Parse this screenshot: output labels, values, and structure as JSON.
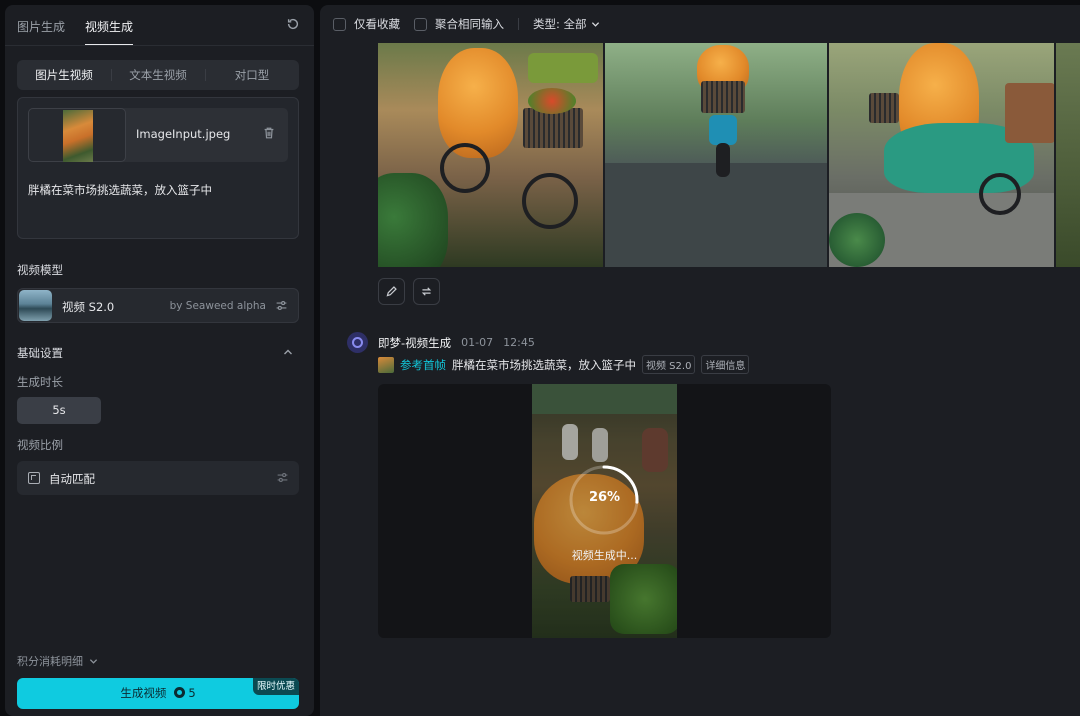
{
  "left": {
    "top_tabs": [
      "图片生成",
      "视频生成"
    ],
    "mode_tabs": [
      "图片生视频",
      "文本生视频",
      "对口型"
    ],
    "upload": {
      "file_name": "ImageInput.jpeg"
    },
    "prompt": "胖橘在菜市场挑选蔬菜，放入篮子中",
    "model_section_label": "视频模型",
    "model": {
      "name": "视频 S2.0",
      "by": "by Seaweed alpha"
    },
    "basic_settings_label": "基础设置",
    "duration_label": "生成时长",
    "duration_value": "5s",
    "ratio_label": "视频比例",
    "ratio_value": "自动匹配",
    "credit_detail_label": "积分消耗明细",
    "generate_button": {
      "label": "生成视频",
      "cost": "5",
      "promo": "限时优惠"
    }
  },
  "right": {
    "filters": {
      "collect_only": "仅看收藏",
      "merge_inputs": "聚合相同输入",
      "type_select": "类型: 全部"
    },
    "entry": {
      "name": "即梦-视频生成",
      "date": "01-07",
      "time": "12:45",
      "ref_label": "参考首帧",
      "prompt": "胖橘在菜市场挑选蔬菜，放入篮子中",
      "model_tag": "视频 S2.0",
      "detail_tag": "详细信息",
      "progress_text": "26%",
      "progress_value": 0.26,
      "status_text": "视频生成中..."
    }
  },
  "colors": {
    "accent": "#0fcbe0",
    "ref_link": "#12c7da",
    "panel": "#1c1e23",
    "background": "#0c0d10"
  },
  "icons": [
    "refresh-icon",
    "trash-icon",
    "sliders-icon",
    "chevron-up-icon",
    "chevron-down-icon",
    "aspect-ratio-icon",
    "coin-icon",
    "edit-icon",
    "regenerate-icon"
  ]
}
